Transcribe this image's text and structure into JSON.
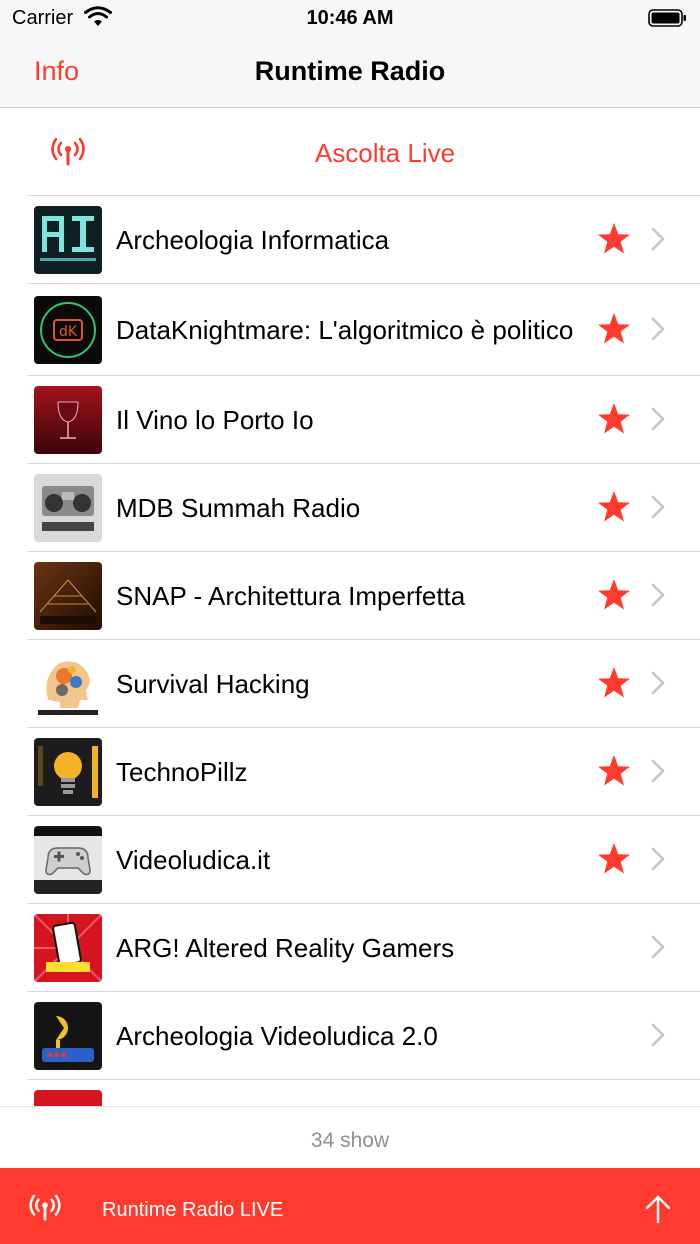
{
  "status_bar": {
    "carrier": "Carrier",
    "time": "10:46 AM"
  },
  "nav": {
    "left_button": "Info",
    "title": "Runtime Radio"
  },
  "live": {
    "label": "Ascolta Live",
    "icon": "antenna-icon"
  },
  "shows": [
    {
      "title": "Archeologia Informatica",
      "favorite": true
    },
    {
      "title": "DataKnightmare: L'algoritmico è politico",
      "favorite": true
    },
    {
      "title": "Il Vino lo Porto Io",
      "favorite": true
    },
    {
      "title": "MDB Summah Radio",
      "favorite": true
    },
    {
      "title": "SNAP - Architettura Imperfetta",
      "favorite": true
    },
    {
      "title": "Survival Hacking",
      "favorite": true
    },
    {
      "title": "TechnoPillz",
      "favorite": true
    },
    {
      "title": "Videoludica.it",
      "favorite": true
    },
    {
      "title": "ARG! Altered Reality Gamers",
      "favorite": false
    },
    {
      "title": "Archeologia Videoludica 2.0",
      "favorite": false
    }
  ],
  "footer": {
    "count": "34 show"
  },
  "player": {
    "label": "Runtime Radio LIVE",
    "icon": "antenna-icon",
    "action_icon": "arrow-up-icon"
  },
  "colors": {
    "accent": "#ff3b30",
    "separator": "#d8d8d8",
    "secondary_text": "#8e8e93"
  }
}
